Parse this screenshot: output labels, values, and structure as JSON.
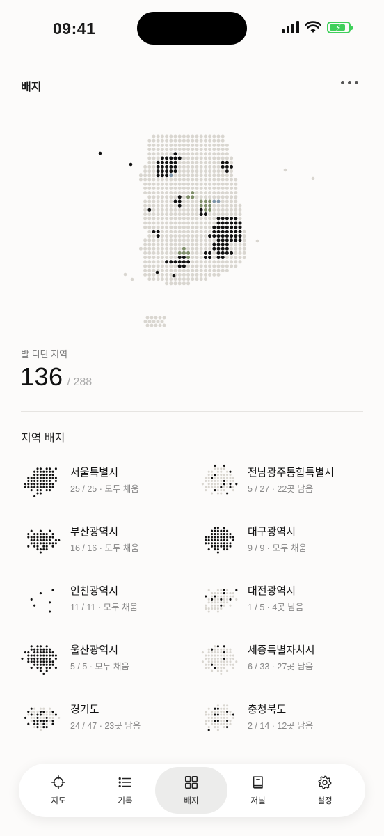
{
  "status_bar": {
    "time": "09:41"
  },
  "header": {
    "title": "배지",
    "more_icon": "more-horizontal-icon"
  },
  "stats": {
    "label": "발 디딘 지역",
    "visited": "136",
    "total": "/ 288"
  },
  "section": {
    "title": "지역 배지"
  },
  "badges": [
    {
      "name": "서울특별시",
      "sub": "25 / 25 · 모두 채움"
    },
    {
      "name": "전남광주통합특별시",
      "sub": "5 / 27 · 22곳 남음"
    },
    {
      "name": "부산광역시",
      "sub": "16 / 16 · 모두 채움"
    },
    {
      "name": "대구광역시",
      "sub": "9 / 9 · 모두 채움"
    },
    {
      "name": "인천광역시",
      "sub": "11 / 11 · 모두 채움"
    },
    {
      "name": "대전광역시",
      "sub": "1 / 5 · 4곳 남음"
    },
    {
      "name": "울산광역시",
      "sub": "5 / 5 · 모두 채움"
    },
    {
      "name": "세종특별자치시",
      "sub": "6 / 33 · 27곳 남음"
    },
    {
      "name": "경기도",
      "sub": "24 / 47 · 23곳 남음"
    },
    {
      "name": "충청북도",
      "sub": "2 / 14 · 12곳 남음"
    }
  ],
  "tabs": [
    {
      "label": "지도",
      "icon": "crosshair-icon"
    },
    {
      "label": "기록",
      "icon": "list-icon"
    },
    {
      "label": "배지",
      "icon": "grid-icon",
      "active": true
    },
    {
      "label": "저널",
      "icon": "book-icon"
    },
    {
      "label": "설정",
      "icon": "gear-icon"
    }
  ],
  "colors": {
    "visited": "#111111",
    "unvisited": "#d9d6d0",
    "accent_green": "#7f8f6a",
    "accent_blue": "#7f95a8",
    "battery": "#3fcf5a"
  }
}
